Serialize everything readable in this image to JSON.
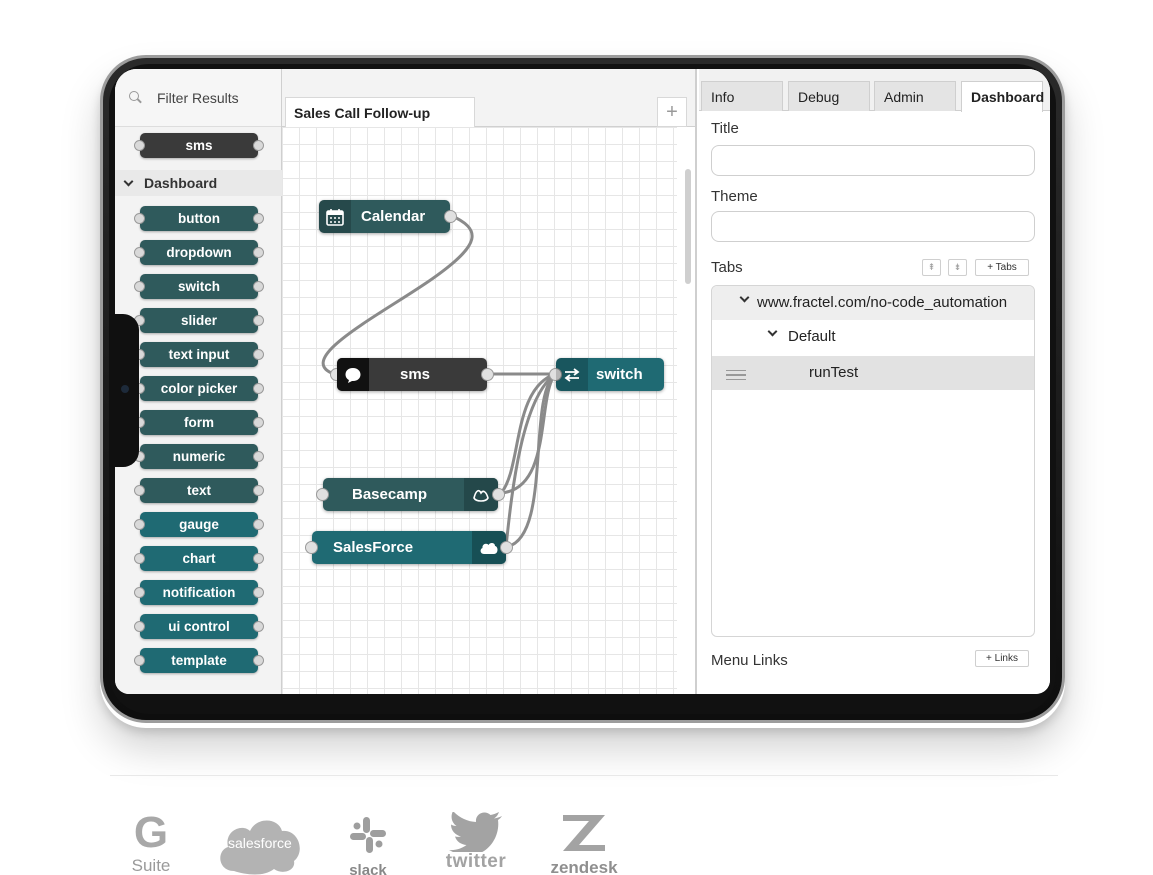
{
  "palette": {
    "search_placeholder": "Filter Results",
    "top_node": "sms",
    "category": "Dashboard",
    "nodes": [
      "button",
      "dropdown",
      "switch",
      "slider",
      "text input",
      "color picker",
      "form",
      "numeric",
      "text",
      "gauge",
      "chart",
      "notification",
      "ui control",
      "template"
    ]
  },
  "workspace": {
    "flow_tab": "Sales Call Follow-up",
    "add_tab": "+",
    "nodes": {
      "calendar": "Calendar",
      "sms": "sms",
      "switch": "switch",
      "basecamp": "Basecamp",
      "salesforce": "SalesForce"
    }
  },
  "sidebar": {
    "tabs": [
      "Info",
      "Debug",
      "Admin",
      "Dashboard"
    ],
    "active_tab": "Dashboard",
    "title_label": "Title",
    "theme_label": "Theme",
    "tabs_label": "Tabs",
    "add_tabs_button": "+ Tabs",
    "tree": {
      "site": "www.fractel.com/no-code_automation",
      "group": "Default",
      "item": "runTest"
    },
    "menu_links_label": "Menu Links",
    "add_links_button": "+ Links"
  },
  "logos": {
    "gsuite_g": "G",
    "gsuite_suite": "Suite",
    "salesforce": "salesforce",
    "slack": "slack",
    "twitter": "twitter",
    "zendesk": "zendesk"
  },
  "colors": {
    "teal_dark": "#2f5a5c",
    "teal": "#1f6a73",
    "sms_dark": "#3a3a3a"
  }
}
